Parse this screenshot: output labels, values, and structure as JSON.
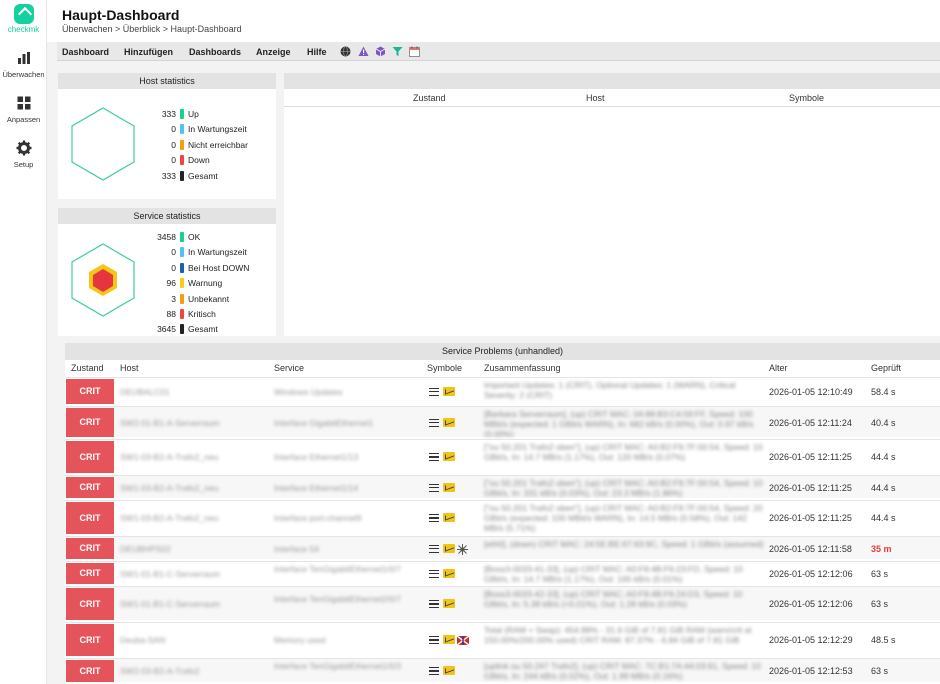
{
  "app": {
    "logo_text": "checkmk"
  },
  "sidebar": {
    "items": [
      {
        "label": "Überwachen",
        "icon": "bar-chart-icon"
      },
      {
        "label": "Anpassen",
        "icon": "grid-icon"
      },
      {
        "label": "Setup",
        "icon": "gear-icon"
      }
    ]
  },
  "header": {
    "title": "Haupt-Dashboard",
    "breadcrumb": "Überwachen > Überblick > Haupt-Dashboard"
  },
  "menu": {
    "items": [
      "Dashboard",
      "Hinzufügen",
      "Dashboards",
      "Anzeige",
      "Hilfe"
    ]
  },
  "host_stats": {
    "title": "Host statistics",
    "rows": [
      {
        "value": "333",
        "label": "Up",
        "color": "#13d38e"
      },
      {
        "value": "0",
        "label": "In Wartungszeit",
        "color": "#4fc3f7"
      },
      {
        "value": "0",
        "label": "Nicht erreichbar",
        "color": "#f59e0b"
      },
      {
        "value": "0",
        "label": "Down",
        "color": "#ef4444"
      },
      {
        "value": "333",
        "label": "Gesamt",
        "color": "#222222"
      }
    ]
  },
  "service_stats": {
    "title": "Service statistics",
    "rows": [
      {
        "value": "3458",
        "label": "OK",
        "color": "#13d38e"
      },
      {
        "value": "0",
        "label": "In Wartungszeit",
        "color": "#4fc3f7"
      },
      {
        "value": "0",
        "label": "Bei Host DOWN",
        "color": "#1e5fa8"
      },
      {
        "value": "96",
        "label": "Warnung",
        "color": "#facc15"
      },
      {
        "value": "3",
        "label": "Unbekannt",
        "color": "#f59e0b"
      },
      {
        "value": "88",
        "label": "Kritisch",
        "color": "#ef4444"
      },
      {
        "value": "3645",
        "label": "Gesamt",
        "color": "#222222"
      }
    ]
  },
  "host_problems": {
    "columns": [
      "Zustand",
      "Host",
      "Symbole"
    ]
  },
  "service_problems": {
    "title": "Service Problems (unhandled)",
    "columns": [
      "Zustand",
      "Host",
      "Service",
      "Symbole",
      "Zusammenfassung",
      "Alter",
      "Geprüft"
    ],
    "rows": [
      {
        "state": "CRIT",
        "host": "DEUBALC01",
        "service": "Windows Updates",
        "summary": "Important Updates: 1 (CRIT), Optional Updates: 1 (WARN), Critical Severity: 2 (CRIT)",
        "age": "2026-01-05 12:10:49",
        "checked": "58.4 s",
        "icons": [
          "menu",
          "graph"
        ]
      },
      {
        "state": "CRIT",
        "host": "SW2-01-B1-A-Serverraum",
        "service": "Interface GigabitEthernet1",
        "summary": "[Barbara Serverraum], (up) CRIT MAC: 04:88:B3:C4:59:FF, Speed: 100 MBit/s (expected: 1 GBit/s WARN), In: 682 kB/s (0.00%), Out: 0.97 kB/s (0.00%)",
        "age": "2026-01-05 12:11:24",
        "checked": "40.4 s",
        "icons": [
          "menu",
          "graph"
        ]
      },
      {
        "state": "CRIT",
        "host": "SW1-03-B2-A-Trafo2_neu",
        "service": "Interface Ethernet1/13",
        "summary": "[\"ou 50.201 Trafo2 oben\"], (up) CRIT MAC: A0:B2:F9:7F:00:54, Speed: 10 GBit/s, In: 14.7 MB/s (1.17%), Out: 120 MB/s (0.07%)",
        "age": "2026-01-05 12:11:25",
        "checked": "44.4 s",
        "icons": [
          "menu",
          "graph"
        ]
      },
      {
        "state": "CRIT",
        "host": "SW1-03-B2-A-Trafo2_neu",
        "service": "Interface Ethernet1/14",
        "summary": "[\"ou 50.201 Trafo2 oben\"], (up) CRIT MAC: A0:B2:F9:7F:00:54, Speed: 10 GBit/s, In: 331 kB/s (0.03%), Out: 23.3 MB/s (1.86%)",
        "age": "2026-01-05 12:11:25",
        "checked": "44.4 s",
        "icons": [
          "menu",
          "graph"
        ]
      },
      {
        "state": "CRIT",
        "host": "SW1-03-B2-A-Trafo2_neu",
        "service": "Interface port-channel9",
        "summary": "[\"ou 50.201 Trafo2 oben\"], (up) CRIT MAC: A0:B2:F9:7F:00:54, Speed: 20 GBit/s (expected: 100 MBit/s WARN), In: 14.5 MB/s (0.58%), Out: 142 MB/s (5.71%)",
        "age": "2026-01-05 12:11:25",
        "checked": "44.4 s",
        "icons": [
          "menu",
          "graph"
        ]
      },
      {
        "state": "CRIT",
        "host": "DEUBHPS02",
        "service": "Interface 54",
        "summary": "[eth0], (down) CRIT MAC: 24:5E:BE:67:63:9C, Speed: 1 GBit/s (assumed)",
        "age": "2026-01-05 12:11:58",
        "checked": "35 m",
        "checked_red": true,
        "icons": [
          "menu",
          "graph",
          "network"
        ]
      },
      {
        "state": "CRIT",
        "host": "SW1-01-B1-C-Serverraum",
        "service": "Interface TenGigabitEthernet1/0/7",
        "summary": "[Boss3-0033-41-33], (up) CRIT MAC: A0:F8:4B:F6:23:FD, Speed: 10 GBit/s, In: 14.7 MB/s (1.17%), Out: 165 kB/s (0.01%)",
        "age": "2026-01-05 12:12:06",
        "checked": "63 s",
        "icons": [
          "menu",
          "graph"
        ]
      },
      {
        "state": "CRIT",
        "host": "SW1-01-B1-C-Serverraum",
        "service": "Interface TenGigabitEthernet2/0/7",
        "summary": "[Boss3-0033-42-33], (up) CRIT MAC: A0:F8:4B:F6:24:D3, Speed: 10 GBit/s, In: 5.38 kB/s (<0.01%), Out: 1.28 kB/s (0.03%)",
        "age": "2026-01-05 12:12:06",
        "checked": "63 s",
        "icons": [
          "menu",
          "graph"
        ]
      },
      {
        "state": "CRIT",
        "host": "Deuba-SAN",
        "service": "Memory used",
        "summary": "Total (RAM + Swap): 454.88% - 31.6 GiB of 7.81 GiB RAM (warn/crit at 150.00%/200.00% used) CRIT RAM: 87.37% - 6.84 GiB of 7.81 GiB",
        "age": "2026-01-05 12:12:29",
        "checked": "48.5 s",
        "icons": [
          "menu",
          "graph",
          "flag"
        ]
      },
      {
        "state": "CRIT",
        "host": "SW2-03-B2-A-Trafo2",
        "service": "Interface TenGigabitEthernet1/0/3",
        "summary": "[uplink ou 50.247 Trafo2], (up) CRIT MAC: 7C:B1:7A:44:03:91, Speed: 10 GBit/s, In: 244 kB/s (0.02%), Out: 1.99 MB/s (0.16%)",
        "age": "2026-01-05 12:12:53",
        "checked": "63 s",
        "icons": [
          "menu",
          "graph"
        ]
      }
    ]
  }
}
